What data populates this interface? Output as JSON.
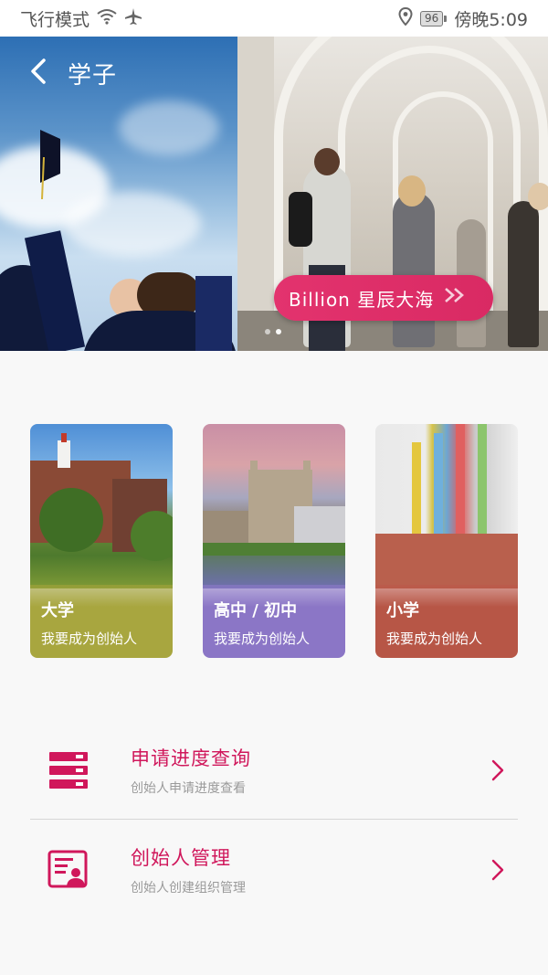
{
  "status_bar": {
    "left_text": "飞行模式",
    "battery": "96",
    "time": "傍晚5:09",
    "icons": [
      "wifi-icon",
      "airplane-icon",
      "location-icon",
      "battery-icon"
    ]
  },
  "header": {
    "title": "学子",
    "back_icon": "chevron-left-icon"
  },
  "banner": {
    "promo_label": "Billion 星辰大海",
    "promo_icon": "double-chevron-right-icon",
    "slide_count": 2,
    "active_slide": 2
  },
  "cards": [
    {
      "title": "大学",
      "subtitle": "我要成为创始人",
      "color": "#a8a63f"
    },
    {
      "title": "高中 / 初中",
      "subtitle": "我要成为创始人",
      "color": "#8b76c6"
    },
    {
      "title": "小学",
      "subtitle": "我要成为创始人",
      "color": "#b75646"
    }
  ],
  "menu": [
    {
      "title": "申请进度查询",
      "subtitle": "创始人申请进度查看",
      "icon": "list-progress-icon"
    },
    {
      "title": "创始人管理",
      "subtitle": "创始人创建组织管理",
      "icon": "founder-card-icon"
    }
  ],
  "colors": {
    "accent": "#d0175b",
    "promo": "#e3336e",
    "background": "#f8f8f8"
  }
}
